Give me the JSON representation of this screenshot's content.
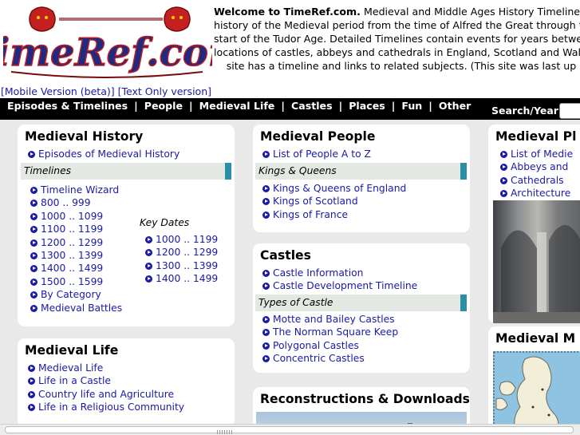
{
  "header": {
    "logo_text": "TimeRef.com",
    "welcome_bold": "Welcome to TimeRef.com.",
    "welcome_lines": [
      "Medieval and Middle Ages History Timelines f",
      "history of the Medieval period from the time of Alfred the Great through the N",
      "start of the Tudor Age. Detailed Timelines contain events for years between",
      "locations of castles, abbeys and cathedrals in England, Scotland and Wales. E",
      "site has a timeline and links to related subjects. (This site was last up"
    ],
    "mobile_link": "[Mobile Version (beta)]",
    "text_only_link": "[Text Only version]"
  },
  "nav": {
    "items": [
      "Episodes & Timelines",
      "People",
      "Medieval Life",
      "Castles",
      "Places",
      "Fun",
      "Other"
    ],
    "separator": "|",
    "search_label": "Search/Year"
  },
  "medieval_history": {
    "title": "Medieval History",
    "top_links": [
      "Episodes of Medieval History"
    ],
    "timelines_label": "Timelines",
    "timeline_links": [
      "Timeline Wizard",
      "800 .. 999",
      "1000 .. 1099",
      "1100 .. 1199",
      "1200 .. 1299",
      "1300 .. 1399",
      "1400 .. 1499",
      "1500 .. 1599",
      "By Category",
      "Medieval Battles"
    ],
    "key_dates_label": "Key Dates",
    "key_dates_links": [
      "1000 .. 1199",
      "1200 .. 1299",
      "1300 .. 1399",
      "1400 .. 1499"
    ]
  },
  "medieval_life": {
    "title": "Medieval Life",
    "links": [
      "Medieval Life",
      "Life in a Castle",
      "Country life and Agriculture",
      "Life in a Religious Community"
    ]
  },
  "medieval_people": {
    "title": "Medieval People",
    "top_links": [
      "List of People A to Z"
    ],
    "kings_label": "Kings & Queens",
    "kings_links": [
      "Kings & Queens of England",
      "Kings of Scotland",
      "Kings of France"
    ]
  },
  "castles": {
    "title": "Castles",
    "top_links": [
      "Castle Information",
      "Castle Development Timeline"
    ],
    "types_label": "Types of Castle",
    "types_links": [
      "Motte and Bailey Castles",
      "The Norman Square Keep",
      "Polygonal Castles",
      "Concentric Castles"
    ]
  },
  "reconstructions": {
    "title": "Reconstructions & Downloads"
  },
  "medieval_places": {
    "title": "Medieval Pl",
    "links": [
      "List of Medie",
      "Abbeys and",
      "Cathedrals",
      "Architecture"
    ]
  },
  "medieval_maps": {
    "title": "Medieval M"
  },
  "colors": {
    "link": "#1a1aa6",
    "nav_bg": "#000000",
    "subhead_bg": "#e4e8e2",
    "subhead_accent": "#2a8ea6",
    "page_bg": "#e9e9e9"
  }
}
